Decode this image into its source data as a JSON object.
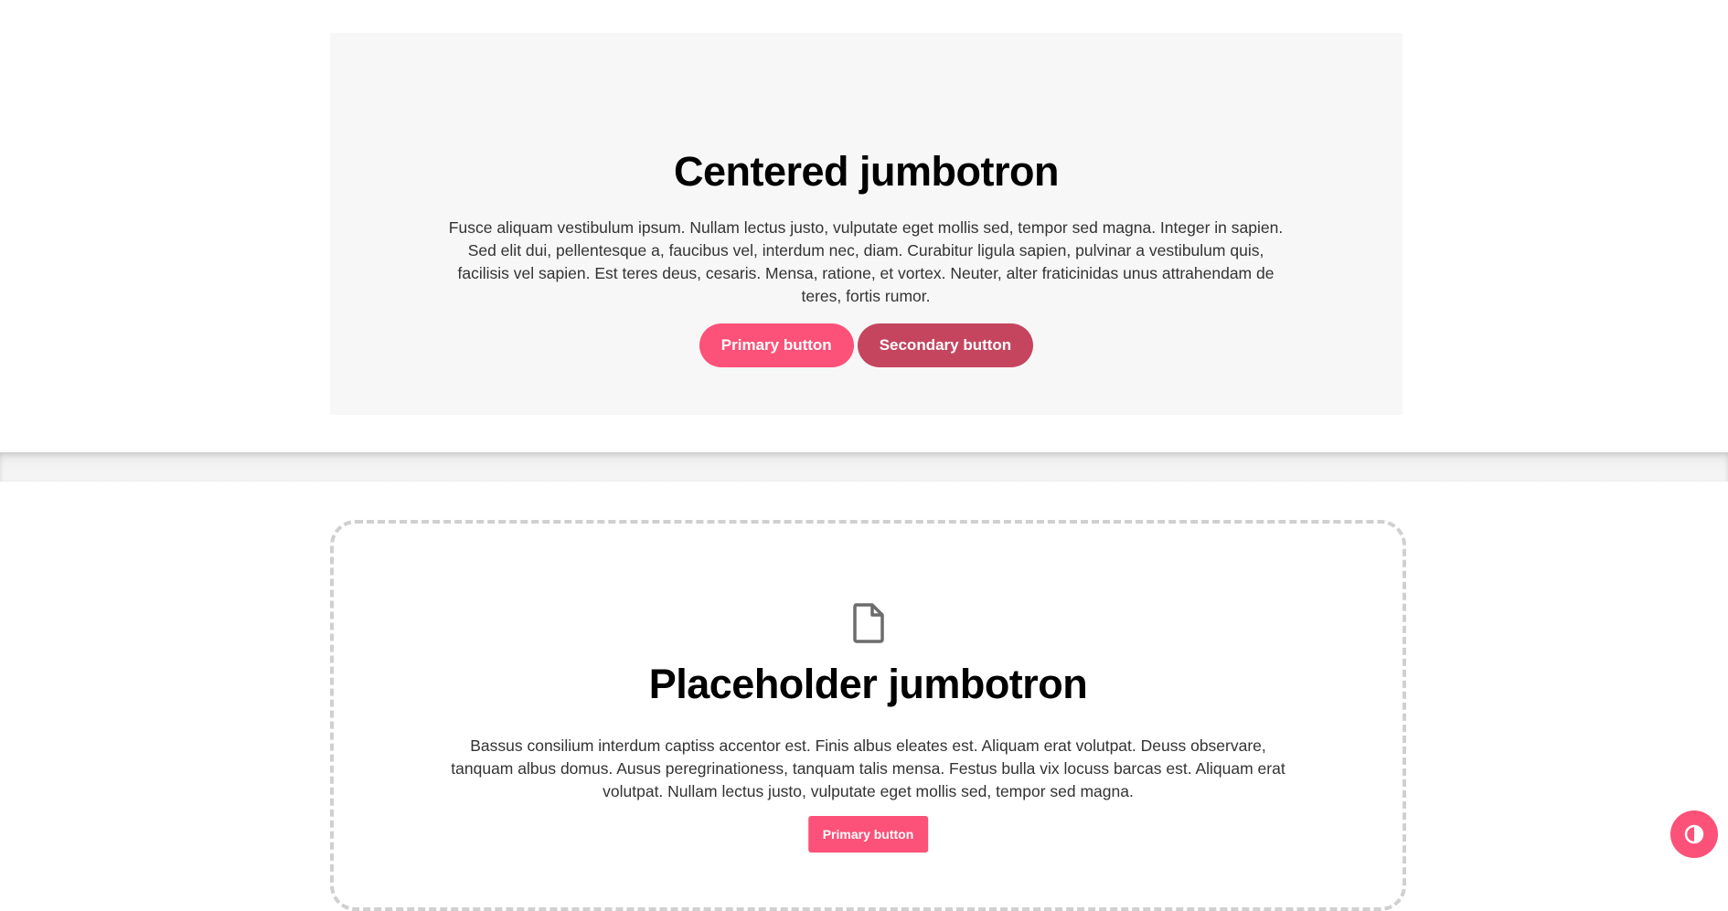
{
  "centered_jumbotron": {
    "title": "Centered jumbotron",
    "text": "Fusce aliquam vestibulum ipsum. Nullam lectus justo, vulputate eget mollis sed, tempor sed magna. Integer in sapien. Sed elit dui, pellentesque a, faucibus vel, interdum nec, diam. Curabitur ligula sapien, pulvinar a vestibulum quis, facilisis vel sapien. Est teres deus, cesaris. Mensa, ratione, et vortex. Neuter, alter fraticinidas unus attrahendam de teres, fortis rumor.",
    "primary_button": "Primary button",
    "secondary_button": "Secondary button"
  },
  "placeholder_jumbotron": {
    "icon": "file-icon",
    "title": "Placeholder jumbotron",
    "text": "Bassus consilium interdum captiss accentor est. Finis albus eleates est. Aliquam erat volutpat. Deuss observare, tanquam albus domus. Ausus peregrinationess, tanquam talis mensa. Festus bulla vix locuss barcas est. Aliquam erat volutpat. Nullam lectus justo, vulputate eget mollis sed, tempor sed magna.",
    "primary_button": "Primary button"
  },
  "theme_toggle": {
    "icon": "contrast-icon"
  },
  "colors": {
    "primary": "#fc5178",
    "secondary": "#c5455f",
    "jumbotron_bg": "#f7f7f7",
    "placeholder_border": "#d0d0d0"
  }
}
